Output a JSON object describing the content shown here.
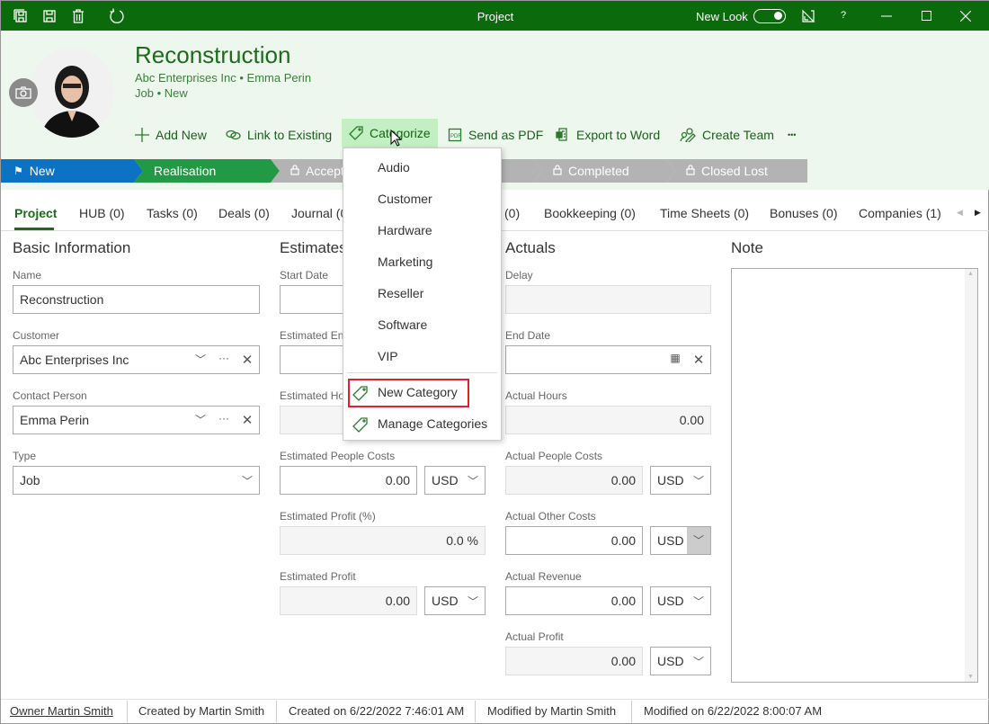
{
  "titlebar": {
    "title": "Project",
    "new_look_label": "New Look",
    "new_look_on": true,
    "help": "?"
  },
  "header": {
    "title": "Reconstruction",
    "customer": "Abc Enterprises Inc",
    "contact": "Emma Perin",
    "type": "Job",
    "status": "New",
    "bullet": "•"
  },
  "toolbar": {
    "add_new": "Add New",
    "link_existing": "Link to Existing",
    "categorize": "Categorize",
    "send_pdf": "Send as PDF",
    "export_word": "Export to Word",
    "create_team": "Create Team",
    "more": "•••"
  },
  "stages": [
    {
      "label": "New",
      "color": "#0b72c4"
    },
    {
      "label": "Realisation",
      "color": "#229a45"
    },
    {
      "label": "Acceptance",
      "color": "#b3b3b3"
    },
    {
      "label": "",
      "color": "#b3b3b3"
    },
    {
      "label": "Completed",
      "color": "#b3b3b3"
    },
    {
      "label": "Closed Lost",
      "color": "#b3b3b3"
    }
  ],
  "tabs": [
    "Project",
    "HUB (0)",
    "Tasks (0)",
    "Deals (0)",
    "Journal (0)",
    "(0)",
    "Bookkeeping (0)",
    "Time Sheets (0)",
    "Bonuses (0)",
    "Companies (1)"
  ],
  "basic": {
    "title": "Basic Information",
    "name_label": "Name",
    "name": "Reconstruction",
    "customer_label": "Customer",
    "customer": "Abc Enterprises Inc",
    "contact_label": "Contact Person",
    "contact": "Emma Perin",
    "type_label": "Type",
    "type": "Job"
  },
  "estimates": {
    "title": "Estimates",
    "start_label": "Start Date",
    "end_label": "Estimated End Date",
    "hours_label": "Estimated Hours",
    "people_label": "Estimated People Costs",
    "people": "0.00",
    "people_cur": "USD",
    "profit_pct_label": "Estimated Profit (%)",
    "profit_pct": "0.0 %",
    "profit_label": "Estimated Profit",
    "profit": "0.00",
    "profit_cur": "USD"
  },
  "actuals": {
    "title": "Actuals",
    "delay_label": "Delay",
    "end_label": "End Date",
    "hours_label": "Actual Hours",
    "hours": "0.00",
    "people_label": "Actual People Costs",
    "people": "0.00",
    "people_cur": "USD",
    "other_label": "Actual Other Costs",
    "other": "0.00",
    "other_cur": "USD",
    "revenue_label": "Actual Revenue",
    "revenue": "0.00",
    "revenue_cur": "USD",
    "profit_label": "Actual Profit",
    "profit": "0.00",
    "profit_cur": "USD"
  },
  "note": {
    "title": "Note"
  },
  "menu": {
    "items": [
      "Audio",
      "Customer",
      "Hardware",
      "Marketing",
      "Reseller",
      "Software",
      "VIP"
    ],
    "new_category": "New Category",
    "manage": "Manage Categories"
  },
  "footer": {
    "owner": "Owner Martin Smith",
    "created_by": "Created by Martin Smith",
    "created_on": "Created on 6/22/2022 7:46:01 AM",
    "modified_by": "Modified by Martin Smith",
    "modified_on": "Modified on 6/22/2022 8:00:07 AM"
  },
  "colors": {
    "titlebar": "#0b6a0b",
    "header_bg": "#eef7ee",
    "accent": "#1b6b1b",
    "highlight_box": "#e0202a"
  }
}
